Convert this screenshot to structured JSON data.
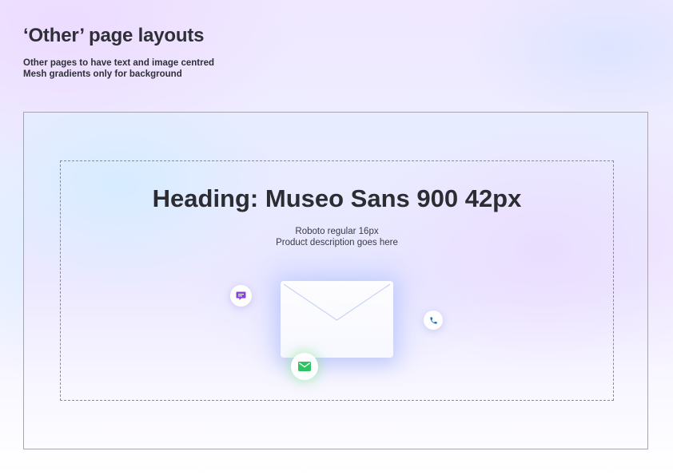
{
  "page": {
    "title": "‘Other’ page layouts",
    "notes": [
      "Other pages to have text and image centred",
      "Mesh gradients only for background"
    ]
  },
  "hero": {
    "heading": "Heading: Museo Sans 900 42px",
    "description_lines": [
      "Roboto regular 16px",
      "Product description goes here"
    ]
  },
  "icons": {
    "chat": "chat-bubble-icon",
    "phone": "phone-icon",
    "mail": "mail-icon",
    "envelope": "envelope-illustration"
  },
  "colors": {
    "chat_icon": "#8b3fe0",
    "phone_icon": "#1c6fc4",
    "mail_icon": "#2fc463",
    "text": "#2c2c33",
    "frame_border": "#a7a4b0"
  }
}
